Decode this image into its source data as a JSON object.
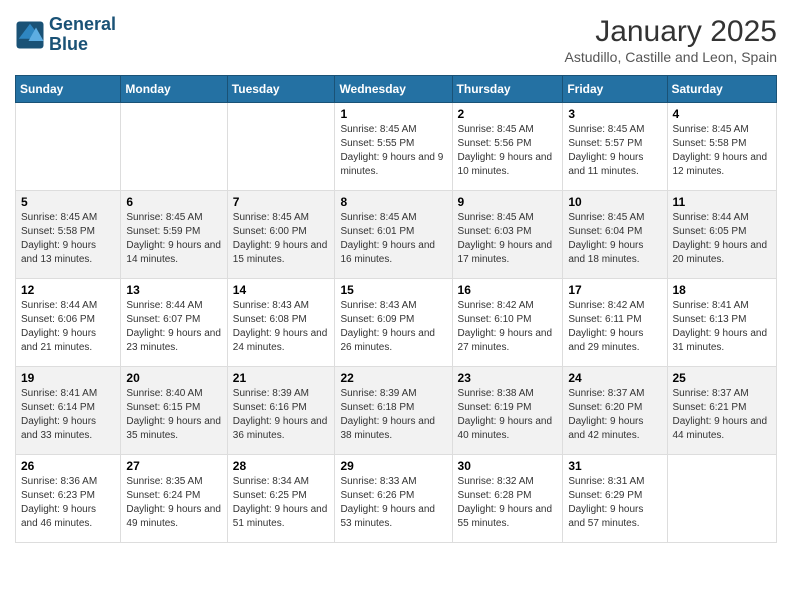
{
  "header": {
    "logo_line1": "General",
    "logo_line2": "Blue",
    "title": "January 2025",
    "subtitle": "Astudillo, Castille and Leon, Spain"
  },
  "weekdays": [
    "Sunday",
    "Monday",
    "Tuesday",
    "Wednesday",
    "Thursday",
    "Friday",
    "Saturday"
  ],
  "weeks": [
    [
      {
        "day": "",
        "info": ""
      },
      {
        "day": "",
        "info": ""
      },
      {
        "day": "",
        "info": ""
      },
      {
        "day": "1",
        "info": "Sunrise: 8:45 AM\nSunset: 5:55 PM\nDaylight: 9 hours and 9 minutes."
      },
      {
        "day": "2",
        "info": "Sunrise: 8:45 AM\nSunset: 5:56 PM\nDaylight: 9 hours and 10 minutes."
      },
      {
        "day": "3",
        "info": "Sunrise: 8:45 AM\nSunset: 5:57 PM\nDaylight: 9 hours and 11 minutes."
      },
      {
        "day": "4",
        "info": "Sunrise: 8:45 AM\nSunset: 5:58 PM\nDaylight: 9 hours and 12 minutes."
      }
    ],
    [
      {
        "day": "5",
        "info": "Sunrise: 8:45 AM\nSunset: 5:58 PM\nDaylight: 9 hours and 13 minutes."
      },
      {
        "day": "6",
        "info": "Sunrise: 8:45 AM\nSunset: 5:59 PM\nDaylight: 9 hours and 14 minutes."
      },
      {
        "day": "7",
        "info": "Sunrise: 8:45 AM\nSunset: 6:00 PM\nDaylight: 9 hours and 15 minutes."
      },
      {
        "day": "8",
        "info": "Sunrise: 8:45 AM\nSunset: 6:01 PM\nDaylight: 9 hours and 16 minutes."
      },
      {
        "day": "9",
        "info": "Sunrise: 8:45 AM\nSunset: 6:03 PM\nDaylight: 9 hours and 17 minutes."
      },
      {
        "day": "10",
        "info": "Sunrise: 8:45 AM\nSunset: 6:04 PM\nDaylight: 9 hours and 18 minutes."
      },
      {
        "day": "11",
        "info": "Sunrise: 8:44 AM\nSunset: 6:05 PM\nDaylight: 9 hours and 20 minutes."
      }
    ],
    [
      {
        "day": "12",
        "info": "Sunrise: 8:44 AM\nSunset: 6:06 PM\nDaylight: 9 hours and 21 minutes."
      },
      {
        "day": "13",
        "info": "Sunrise: 8:44 AM\nSunset: 6:07 PM\nDaylight: 9 hours and 23 minutes."
      },
      {
        "day": "14",
        "info": "Sunrise: 8:43 AM\nSunset: 6:08 PM\nDaylight: 9 hours and 24 minutes."
      },
      {
        "day": "15",
        "info": "Sunrise: 8:43 AM\nSunset: 6:09 PM\nDaylight: 9 hours and 26 minutes."
      },
      {
        "day": "16",
        "info": "Sunrise: 8:42 AM\nSunset: 6:10 PM\nDaylight: 9 hours and 27 minutes."
      },
      {
        "day": "17",
        "info": "Sunrise: 8:42 AM\nSunset: 6:11 PM\nDaylight: 9 hours and 29 minutes."
      },
      {
        "day": "18",
        "info": "Sunrise: 8:41 AM\nSunset: 6:13 PM\nDaylight: 9 hours and 31 minutes."
      }
    ],
    [
      {
        "day": "19",
        "info": "Sunrise: 8:41 AM\nSunset: 6:14 PM\nDaylight: 9 hours and 33 minutes."
      },
      {
        "day": "20",
        "info": "Sunrise: 8:40 AM\nSunset: 6:15 PM\nDaylight: 9 hours and 35 minutes."
      },
      {
        "day": "21",
        "info": "Sunrise: 8:39 AM\nSunset: 6:16 PM\nDaylight: 9 hours and 36 minutes."
      },
      {
        "day": "22",
        "info": "Sunrise: 8:39 AM\nSunset: 6:18 PM\nDaylight: 9 hours and 38 minutes."
      },
      {
        "day": "23",
        "info": "Sunrise: 8:38 AM\nSunset: 6:19 PM\nDaylight: 9 hours and 40 minutes."
      },
      {
        "day": "24",
        "info": "Sunrise: 8:37 AM\nSunset: 6:20 PM\nDaylight: 9 hours and 42 minutes."
      },
      {
        "day": "25",
        "info": "Sunrise: 8:37 AM\nSunset: 6:21 PM\nDaylight: 9 hours and 44 minutes."
      }
    ],
    [
      {
        "day": "26",
        "info": "Sunrise: 8:36 AM\nSunset: 6:23 PM\nDaylight: 9 hours and 46 minutes."
      },
      {
        "day": "27",
        "info": "Sunrise: 8:35 AM\nSunset: 6:24 PM\nDaylight: 9 hours and 49 minutes."
      },
      {
        "day": "28",
        "info": "Sunrise: 8:34 AM\nSunset: 6:25 PM\nDaylight: 9 hours and 51 minutes."
      },
      {
        "day": "29",
        "info": "Sunrise: 8:33 AM\nSunset: 6:26 PM\nDaylight: 9 hours and 53 minutes."
      },
      {
        "day": "30",
        "info": "Sunrise: 8:32 AM\nSunset: 6:28 PM\nDaylight: 9 hours and 55 minutes."
      },
      {
        "day": "31",
        "info": "Sunrise: 8:31 AM\nSunset: 6:29 PM\nDaylight: 9 hours and 57 minutes."
      },
      {
        "day": "",
        "info": ""
      }
    ]
  ]
}
